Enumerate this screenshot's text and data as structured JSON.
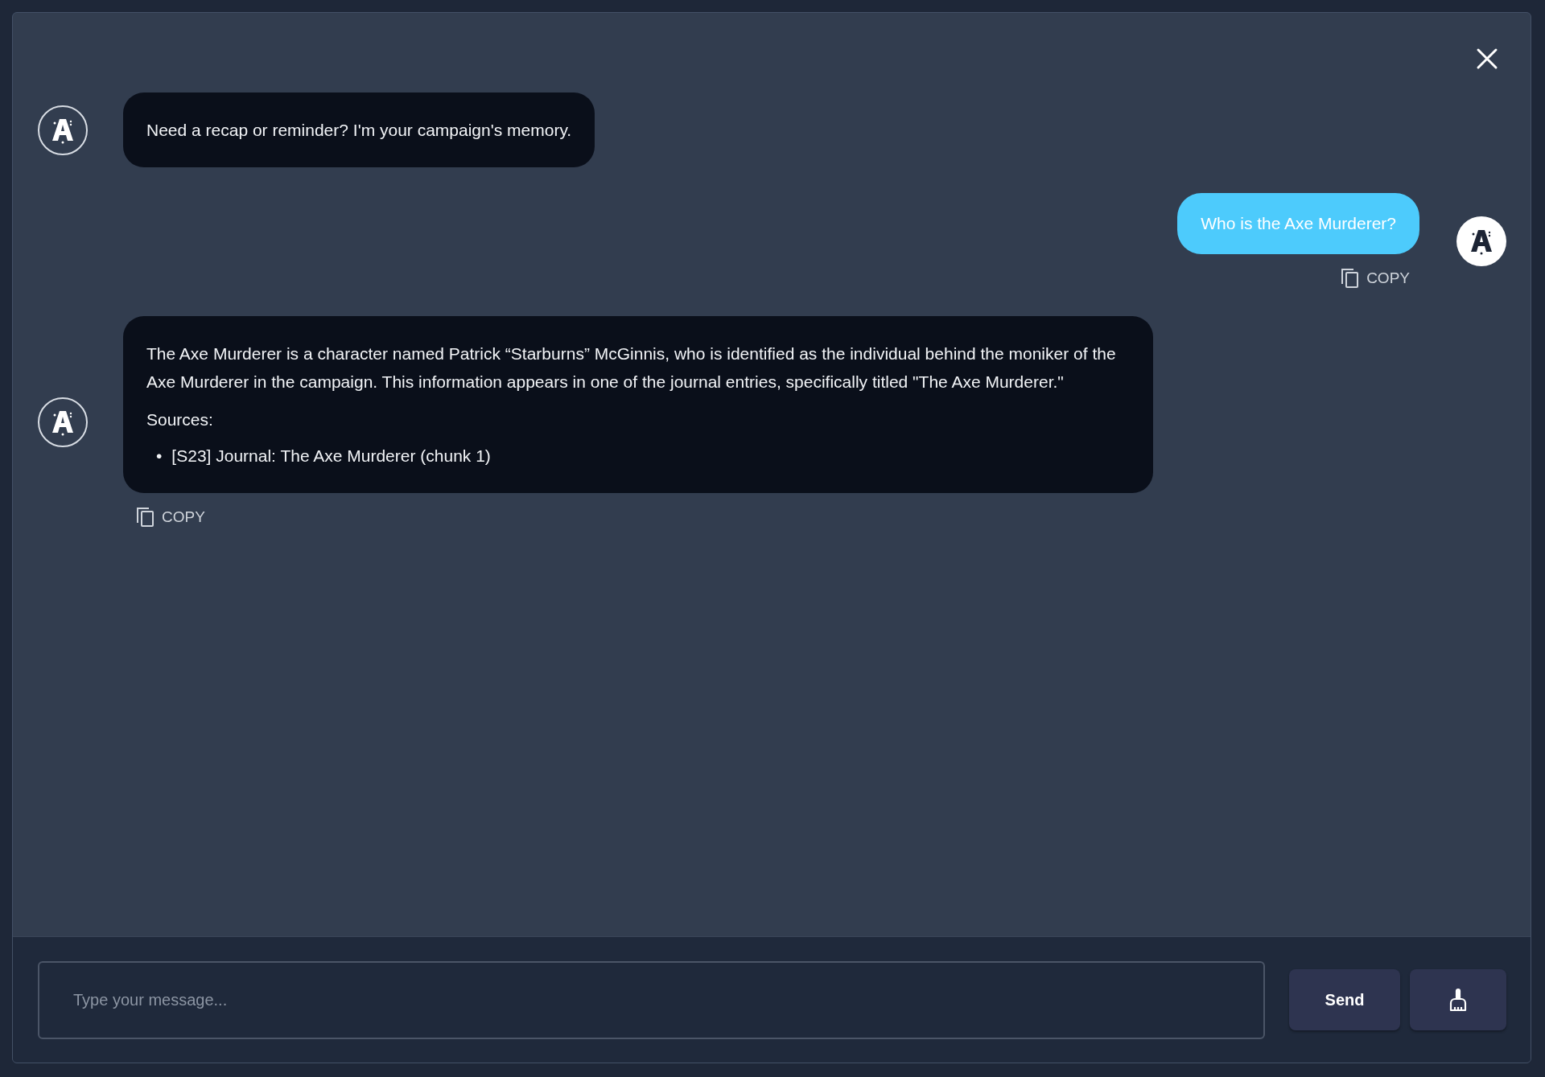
{
  "messages": [
    {
      "kind": "bot",
      "paragraphs": [
        "Need a recap or reminder? I'm your campaign's memory."
      ]
    },
    {
      "kind": "user",
      "paragraphs": [
        "Who is the Axe Murderer?"
      ],
      "copy_label": "COPY"
    },
    {
      "kind": "bot",
      "paragraphs": [
        "The Axe Murderer is a character named Patrick “Starburns” McGinnis, who is identified as the individual behind the moniker of the Axe Murderer in the campaign. This information appears in one of the journal entries, specifically titled \"The Axe Murderer.\"",
        "Sources:"
      ],
      "sources": [
        {
          "bullet": "•",
          "text": "[S23] Journal: The Axe Murderer (chunk 1)"
        }
      ],
      "copy_label": "COPY"
    }
  ],
  "composer": {
    "placeholder": "Type your message...",
    "send_label": "Send"
  }
}
